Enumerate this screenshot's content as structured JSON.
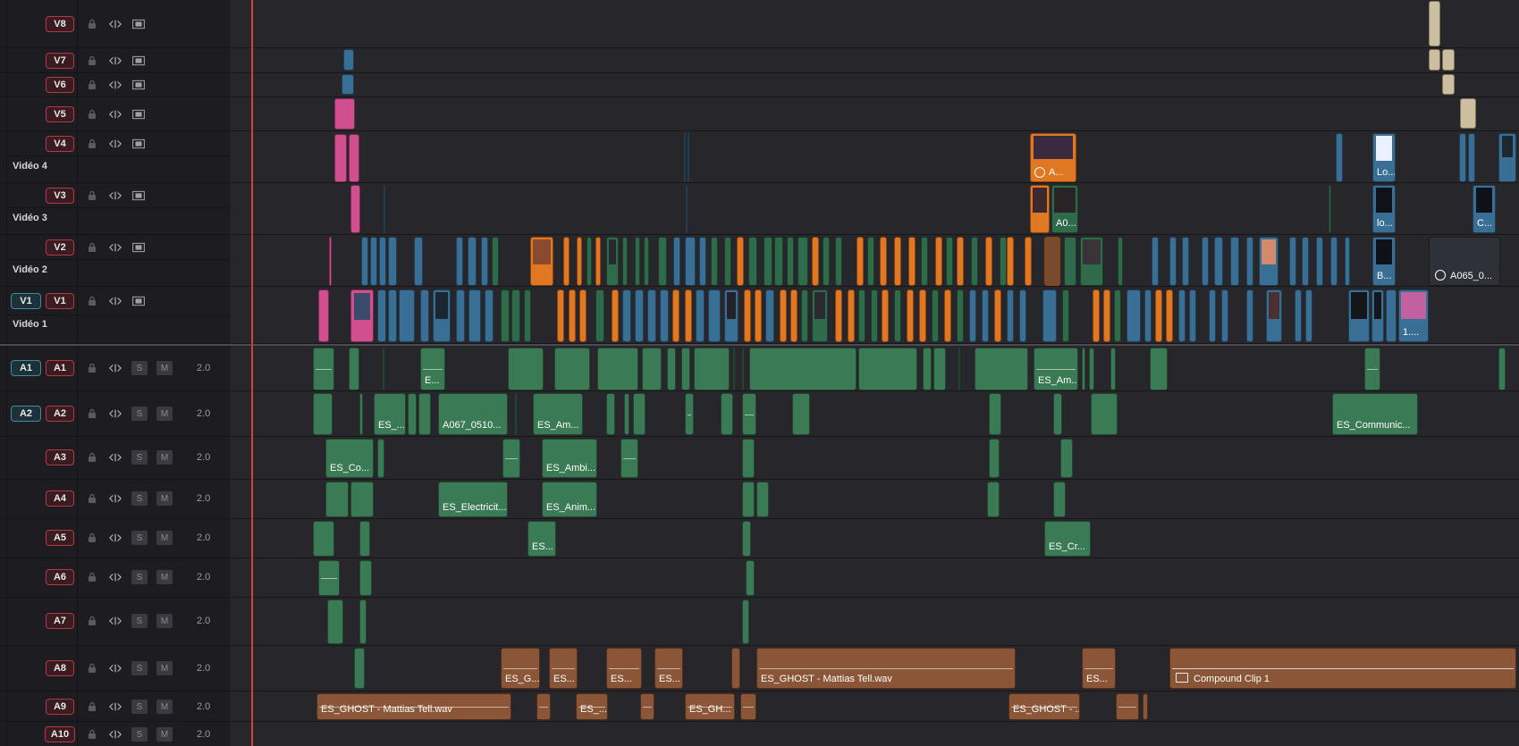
{
  "video_tracks": [
    {
      "id": "V8",
      "name": ""
    },
    {
      "id": "V7",
      "name": ""
    },
    {
      "id": "V6",
      "name": ""
    },
    {
      "id": "V5",
      "name": ""
    },
    {
      "id": "V4",
      "name": "Vidéo 4"
    },
    {
      "id": "V3",
      "name": "Vidéo 3"
    },
    {
      "id": "V2",
      "name": "Vidéo 2"
    },
    {
      "id": "V1",
      "name": "Vidéo 1",
      "source": "V1"
    }
  ],
  "audio_tracks": [
    {
      "id": "A1",
      "source": "A1",
      "channels": "2.0"
    },
    {
      "id": "A2",
      "source": "A2",
      "channels": "2.0"
    },
    {
      "id": "A3",
      "channels": "2.0"
    },
    {
      "id": "A4",
      "channels": "2.0"
    },
    {
      "id": "A5",
      "channels": "2.0"
    },
    {
      "id": "A6",
      "channels": "2.0"
    },
    {
      "id": "A7",
      "channels": "2.0"
    },
    {
      "id": "A8",
      "channels": "2.0"
    },
    {
      "id": "A9",
      "channels": "2.0"
    },
    {
      "id": "A10",
      "channels": "2.0"
    }
  ],
  "controls": {
    "solo": "S",
    "mute": "M"
  },
  "icons": {
    "lock": "lock-icon",
    "link": "link-icon",
    "film": "film-strip-icon"
  },
  "clip_labels": {
    "v4_a": "A...",
    "v4_lo": "Lo...",
    "v3_a0": "A0...",
    "v3_lo": "lo...",
    "v3_c": "C...",
    "v2_b": "B...",
    "v2_a065": "A065_0...",
    "v1_1": "1....",
    "a1_e": "E...",
    "a1_esam": "ES_Am...",
    "a2_es": "ES_...",
    "a2_a067": "A067_0510...",
    "a2_esam": "ES_Am...",
    "a2_comm": "ES_Communic...",
    "a3_esco": "ES_Co...",
    "a3_ambi": "ES_Ambi...",
    "a4_elec": "ES_Electricit...",
    "a4_anim": "ES_Anim...",
    "a5_es": "ES...",
    "a5_cr": "ES_Cr...",
    "a8_esg": "ES_G...",
    "a8_es1": "ES...",
    "a8_es2": "ES...",
    "a8_es3": "ES...",
    "a8_ghost": "ES_GHOST - Mattias Tell.wav",
    "a8_es4": "ES...",
    "a8_compound": "Compound Clip 1",
    "a9_ghost": "ES_GHOST - Mattias Tell.wav",
    "a9_es": "ES_...",
    "a9_esgh": "ES_GH...",
    "a9_ghost2": "ES_GHOST - ..."
  },
  "colors": {
    "video_blue": "#3a6f95",
    "video_orange": "#e07722",
    "video_green": "#2f6a4a",
    "video_pink": "#d14f8e",
    "audio_green": "#3a7a55",
    "audio_brown": "#8a5637",
    "playhead": "#c8463e"
  }
}
